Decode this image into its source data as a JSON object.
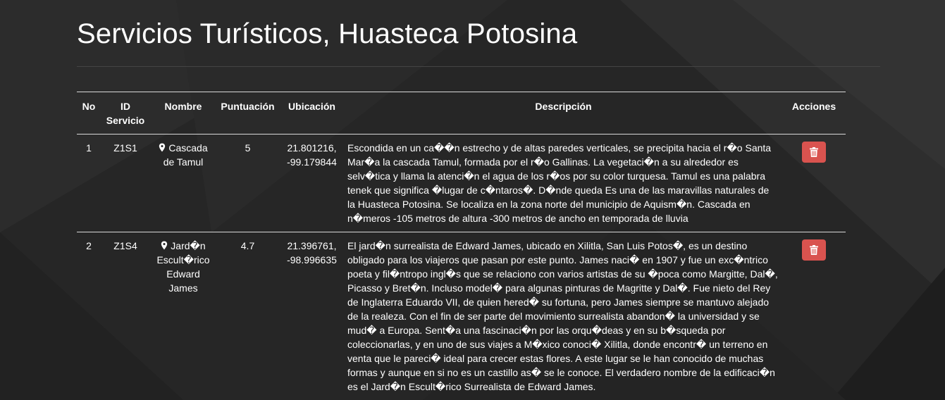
{
  "page": {
    "title": "Servicios Turísticos, Huasteca Potosina"
  },
  "colors": {
    "background": "#262626",
    "delete_button": "#d9534f",
    "rule": "#d9d9d9"
  },
  "table": {
    "headers": {
      "no": "No",
      "id_line1": "ID",
      "id_line2": "Servicio",
      "nombre": "Nombre",
      "puntuacion": "Puntuación",
      "ubicacion": "Ubicación",
      "descripcion": "Descripción",
      "acciones": "Acciones"
    },
    "rows": [
      {
        "no": "1",
        "id": "Z1S1",
        "nombre": "Cascada de Tamul",
        "puntuacion": "5",
        "lat": "21.801216,",
        "lng": "-99.179844",
        "descripcion": "Escondida en un ca��n estrecho y de altas paredes verticales, se precipita hacia el r�o Santa Mar�a la cascada Tamul, formada por el r�o Gallinas. La vegetaci�n a su alrededor es selv�tica y llama la atenci�n el agua de los r�os por su color turquesa. Tamul es una palabra tenek que significa �lugar de c�ntaros�. D�nde queda Es una de las maravillas naturales de la Huasteca Potosina. Se localiza en la zona norte del municipio de Aquism�n. Cascada en n�meros -105 metros de altura -300 metros de ancho en temporada de lluvia",
        "icon": "map-marker-icon",
        "action_icon": "trash-icon"
      },
      {
        "no": "2",
        "id": "Z1S4",
        "nombre": "Jard�n Escult�rico Edward James",
        "puntuacion": "4.7",
        "lat": "21.396761,",
        "lng": "-98.996635",
        "descripcion": "El jard�n surrealista de Edward James, ubicado en Xilitla, San Luis Potos�, es un destino obligado para los viajeros que pasan por este punto. James naci� en 1907 y fue un exc�ntrico poeta y fil�ntropo ingl�s que se relaciono con varios artistas de su �poca como Margitte, Dal�, Picasso y Bret�n. Incluso model� para algunas pinturas de Magritte y Dal�. Fue nieto del Rey de Inglaterra Eduardo VII, de quien hered� su fortuna, pero James siempre se mantuvo alejado de la realeza. Con el fin de ser parte del movimiento surrealista abandon� la universidad y se mud� a Europa. Sent�a una fascinaci�n por las orqu�deas y en su b�squeda por coleccionarlas, y en uno de sus viajes a M�xico conoci� Xilitla, donde encontr� un terreno en venta que le pareci� ideal para crecer estas flores. A este lugar se le han conocido de muchas formas y aunque en si no es un castillo as� se le conoce. El verdadero nombre de la edificaci�n es el Jard�n Escult�rico Surrealista de Edward James.",
        "icon": "map-marker-icon",
        "action_icon": "trash-icon"
      }
    ]
  }
}
